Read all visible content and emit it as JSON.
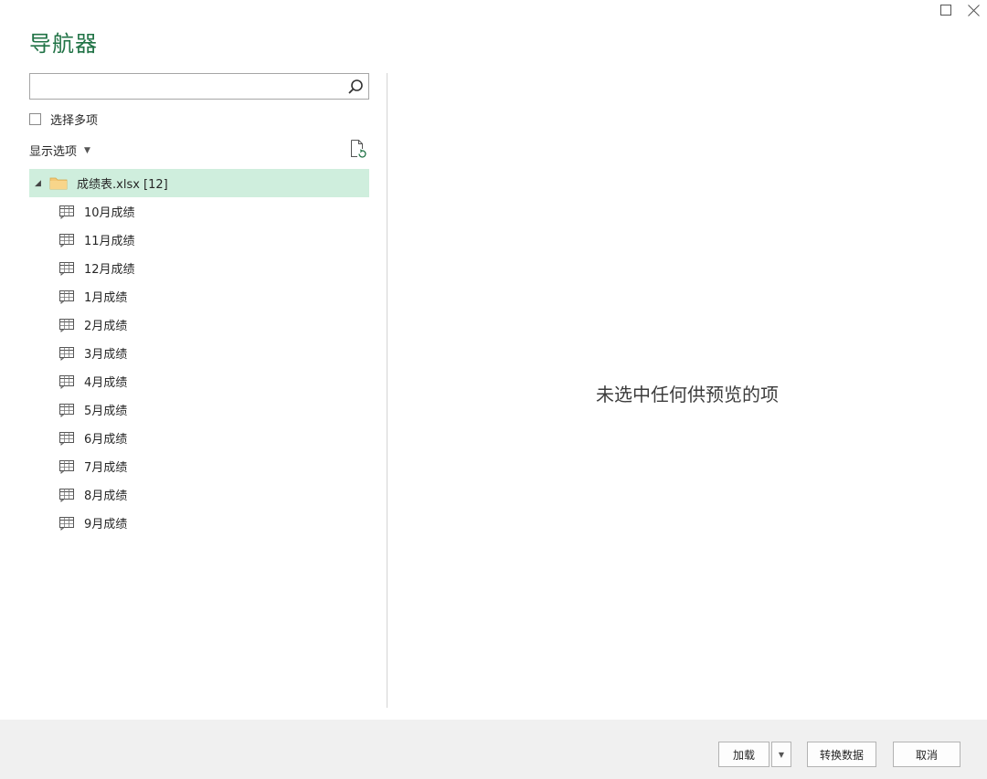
{
  "dialog": {
    "title": "导航器",
    "window_controls": {
      "maximize_icon": "maximize-icon",
      "close_icon": "close-icon"
    }
  },
  "left_panel": {
    "search": {
      "value": "",
      "placeholder": "",
      "icon": "search-icon"
    },
    "select_multiple": {
      "label": "选择多项",
      "checked": false
    },
    "display_options": {
      "label": "显示选项",
      "icon": "caret-down-icon"
    },
    "refresh_icon": "refresh-document-icon",
    "tree": {
      "root": {
        "label": "成绩表.xlsx [12]",
        "expanded": true,
        "selected": true,
        "icon": "folder-icon"
      },
      "items": [
        {
          "label": "10月成绩"
        },
        {
          "label": "11月成绩"
        },
        {
          "label": "12月成绩"
        },
        {
          "label": "1月成绩"
        },
        {
          "label": "2月成绩"
        },
        {
          "label": "3月成绩"
        },
        {
          "label": "4月成绩"
        },
        {
          "label": "5月成绩"
        },
        {
          "label": "6月成绩"
        },
        {
          "label": "7月成绩"
        },
        {
          "label": "8月成绩"
        },
        {
          "label": "9月成绩"
        }
      ],
      "item_icon": "table-icon"
    }
  },
  "preview": {
    "message": "未选中任何供预览的项"
  },
  "footer": {
    "load_label": "加载",
    "transform_label": "转换数据",
    "cancel_label": "取消"
  },
  "colors": {
    "accent": "#217346",
    "selected_row": "#cfeedd",
    "footer_bg": "#f0f0f0"
  }
}
